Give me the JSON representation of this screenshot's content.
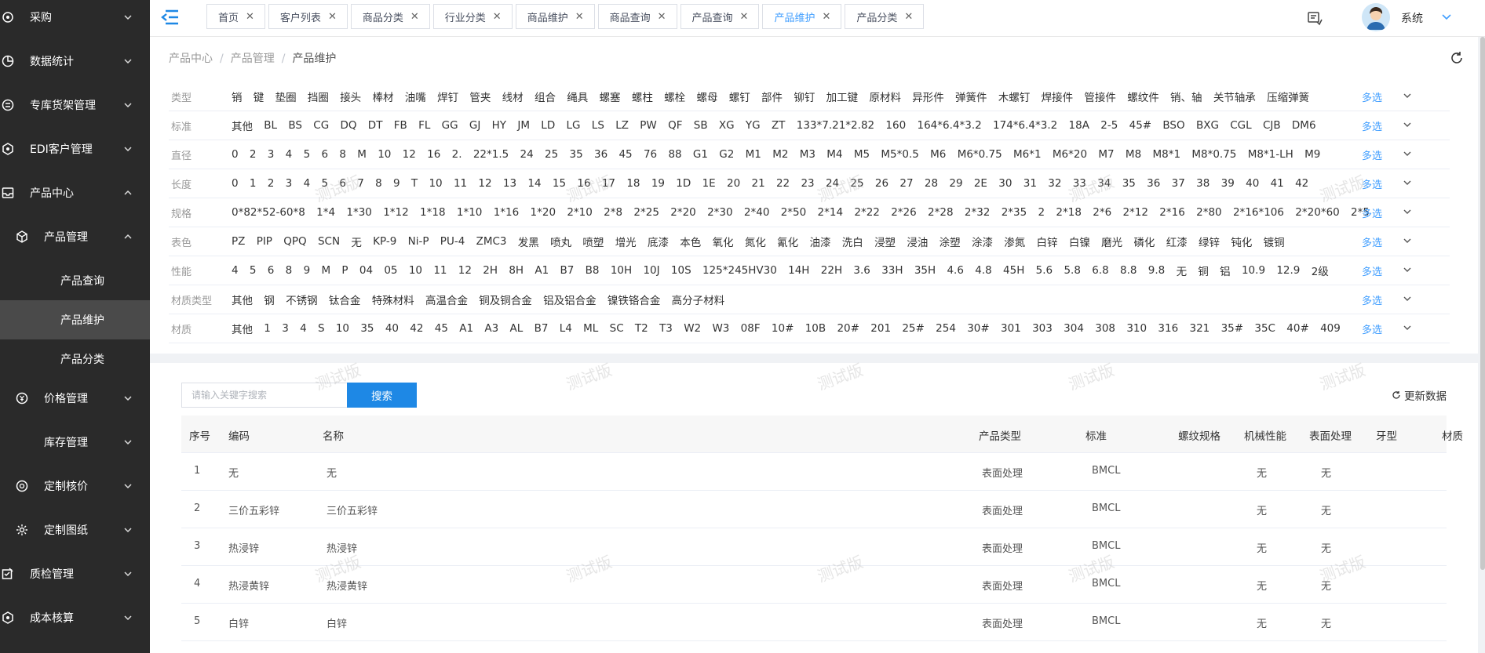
{
  "sidebar": {
    "items": [
      {
        "label": "采购",
        "icon": "circle-icon",
        "expanded": false
      },
      {
        "label": "数据统计",
        "icon": "pie-chart-icon",
        "expanded": false
      },
      {
        "label": "专库货架管理",
        "icon": "shelf-icon",
        "expanded": false
      },
      {
        "label": "EDI客户管理",
        "icon": "hexagon-icon",
        "expanded": false
      },
      {
        "label": "产品中心",
        "icon": "inbox-icon",
        "expanded": true
      },
      {
        "label": "产品管理",
        "icon": "cube-icon",
        "expanded": true
      },
      {
        "label": "产品查询"
      },
      {
        "label": "产品维护",
        "active": true
      },
      {
        "label": "产品分类"
      },
      {
        "label": "价格管理",
        "icon": "currency-icon",
        "expanded": false
      },
      {
        "label": "库存管理",
        "expanded": false
      },
      {
        "label": "定制核价",
        "icon": "target-icon",
        "expanded": false
      },
      {
        "label": "定制图纸",
        "icon": "gear-icon",
        "expanded": false
      },
      {
        "label": "质检管理",
        "icon": "check-edit-icon",
        "expanded": false
      },
      {
        "label": "成本核算",
        "icon": "hexagon-icon",
        "expanded": false
      }
    ]
  },
  "tabs": [
    {
      "label": "首页",
      "active": false
    },
    {
      "label": "客户列表",
      "active": false
    },
    {
      "label": "商品分类",
      "active": false
    },
    {
      "label": "行业分类",
      "active": false
    },
    {
      "label": "商品维护",
      "active": false
    },
    {
      "label": "商品查询",
      "active": false
    },
    {
      "label": "产品查询",
      "active": false
    },
    {
      "label": "产品维护",
      "active": true
    },
    {
      "label": "产品分类",
      "active": false
    }
  ],
  "user": {
    "name": "系统"
  },
  "breadcrumb": [
    "产品中心",
    "产品管理",
    "产品维护"
  ],
  "filters": [
    {
      "label": "类型",
      "options": [
        "销",
        "键",
        "垫圈",
        "挡圈",
        "接头",
        "棒材",
        "油嘴",
        "焊钉",
        "管夹",
        "线材",
        "组合",
        "绳具",
        "螺塞",
        "螺柱",
        "螺栓",
        "螺母",
        "螺钉",
        "部件",
        "铆钉",
        "加工键",
        "原材料",
        "异形件",
        "弹簧件",
        "木螺钉",
        "焊接件",
        "管接件",
        "螺纹件",
        "销、轴",
        "关节轴承",
        "压缩弹簧"
      ],
      "more": "多选"
    },
    {
      "label": "标准",
      "options": [
        "其他",
        "BL",
        "BS",
        "CG",
        "DQ",
        "DT",
        "FB",
        "FL",
        "GG",
        "GJ",
        "HY",
        "JM",
        "LD",
        "LG",
        "LS",
        "LZ",
        "PW",
        "QF",
        "SB",
        "XG",
        "YG",
        "ZT",
        "133*7.21*2.82",
        "160",
        "164*6.4*3.2",
        "174*6.4*3.2",
        "18A",
        "2-5",
        "45#",
        "BSO",
        "BXG",
        "CGL",
        "CJB",
        "DM6"
      ],
      "more": "多选"
    },
    {
      "label": "直径",
      "options": [
        "0",
        "2",
        "3",
        "4",
        "5",
        "6",
        "8",
        "M",
        "10",
        "12",
        "16",
        "2.",
        "22*1.5",
        "24",
        "25",
        "35",
        "36",
        "45",
        "76",
        "88",
        "G1",
        "G2",
        "M1",
        "M2",
        "M3",
        "M4",
        "M5",
        "M5*0.5",
        "M6",
        "M6*0.75",
        "M6*1",
        "M6*20",
        "M7",
        "M8",
        "M8*1",
        "M8*0.75",
        "M8*1-LH",
        "M9"
      ],
      "more": "多选"
    },
    {
      "label": "长度",
      "options": [
        "0",
        "1",
        "2",
        "3",
        "4",
        "5",
        "6",
        "7",
        "8",
        "9",
        "T",
        "10",
        "11",
        "12",
        "13",
        "14",
        "15",
        "16",
        "17",
        "18",
        "19",
        "1D",
        "1E",
        "20",
        "21",
        "22",
        "23",
        "24",
        "25",
        "26",
        "27",
        "28",
        "29",
        "2E",
        "30",
        "31",
        "32",
        "33",
        "34",
        "35",
        "36",
        "37",
        "38",
        "39",
        "40",
        "41",
        "42"
      ],
      "more": "多选"
    },
    {
      "label": "规格",
      "options": [
        "0*82*52-60*8",
        "1*4",
        "1*30",
        "1*12",
        "1*18",
        "1*10",
        "1*16",
        "1*20",
        "2*10",
        "2*8",
        "2*25",
        "2*20",
        "2*30",
        "2*40",
        "2*50",
        "2*14",
        "2*22",
        "2*26",
        "2*28",
        "2*32",
        "2*35",
        "2",
        "2*18",
        "2*6",
        "2*12",
        "2*16",
        "2*80",
        "2*16*106",
        "2*20*60",
        "2*5"
      ],
      "more": "多选"
    },
    {
      "label": "表色",
      "options": [
        "PZ",
        "PIP",
        "QPQ",
        "SCN",
        "无",
        "KP-9",
        "Ni-P",
        "PU-4",
        "ZMC3",
        "发黑",
        "喷丸",
        "喷塑",
        "增光",
        "底漆",
        "本色",
        "氧化",
        "氮化",
        "氰化",
        "油漆",
        "洗白",
        "浸塑",
        "浸油",
        "涂塑",
        "涂漆",
        "渗氮",
        "白锌",
        "白镍",
        "磨光",
        "磷化",
        "红漆",
        "绿锌",
        "钝化",
        "镀铜"
      ],
      "more": "多选"
    },
    {
      "label": "性能",
      "options": [
        "4",
        "5",
        "6",
        "8",
        "9",
        "M",
        "P",
        "04",
        "05",
        "10",
        "11",
        "12",
        "2H",
        "8H",
        "A1",
        "B7",
        "B8",
        "10H",
        "10J",
        "10S",
        "125*245HV30",
        "14H",
        "22H",
        "3.6",
        "33H",
        "35H",
        "4.6",
        "4.8",
        "45H",
        "5.6",
        "5.8",
        "6.8",
        "8.8",
        "9.8",
        "无",
        "铜",
        "铝",
        "10.9",
        "12.9",
        "2级"
      ],
      "more": "多选"
    },
    {
      "label": "材质类型",
      "options": [
        "其他",
        "钢",
        "不锈钢",
        "钛合金",
        "特殊材料",
        "高温合金",
        "铜及铜合金",
        "铝及铝合金",
        "镍铁铬合金",
        "高分子材料"
      ],
      "more": "多选"
    },
    {
      "label": "材质",
      "options": [
        "其他",
        "1",
        "3",
        "4",
        "S",
        "10",
        "35",
        "40",
        "42",
        "45",
        "A1",
        "A3",
        "AL",
        "B7",
        "L4",
        "ML",
        "SC",
        "T2",
        "T3",
        "W2",
        "W3",
        "08F",
        "10#",
        "10B",
        "20#",
        "201",
        "25#",
        "254",
        "30#",
        "301",
        "303",
        "304",
        "308",
        "310",
        "316",
        "321",
        "35#",
        "35C",
        "40#",
        "409"
      ],
      "more": "多选"
    }
  ],
  "search": {
    "placeholder": "请输入关键字搜索",
    "button": "搜索",
    "update": "更新数据"
  },
  "table": {
    "columns": [
      "序号",
      "编码",
      "名称",
      "产品类型",
      "标准",
      "螺纹规格",
      "机械性能",
      "表面处理",
      "牙型",
      "材质"
    ],
    "rows": [
      [
        "1",
        "无",
        "无",
        "表面处理",
        "BMCL",
        "",
        "无",
        "无",
        "",
        ""
      ],
      [
        "2",
        "三价五彩锌",
        "三价五彩锌",
        "表面处理",
        "BMCL",
        "",
        "无",
        "无",
        "",
        ""
      ],
      [
        "3",
        "热浸锌",
        "热浸锌",
        "表面处理",
        "BMCL",
        "",
        "无",
        "无",
        "",
        ""
      ],
      [
        "4",
        "热浸黄锌",
        "热浸黄锌",
        "表面处理",
        "BMCL",
        "",
        "无",
        "无",
        "",
        ""
      ],
      [
        "5",
        "白锌",
        "白锌",
        "表面处理",
        "BMCL",
        "",
        "无",
        "无",
        "",
        ""
      ]
    ]
  },
  "watermark": "测试版",
  "colors": {
    "sidebar_bg": "#2a2a2a",
    "accent": "#409eff",
    "button": "#1e88e5"
  }
}
